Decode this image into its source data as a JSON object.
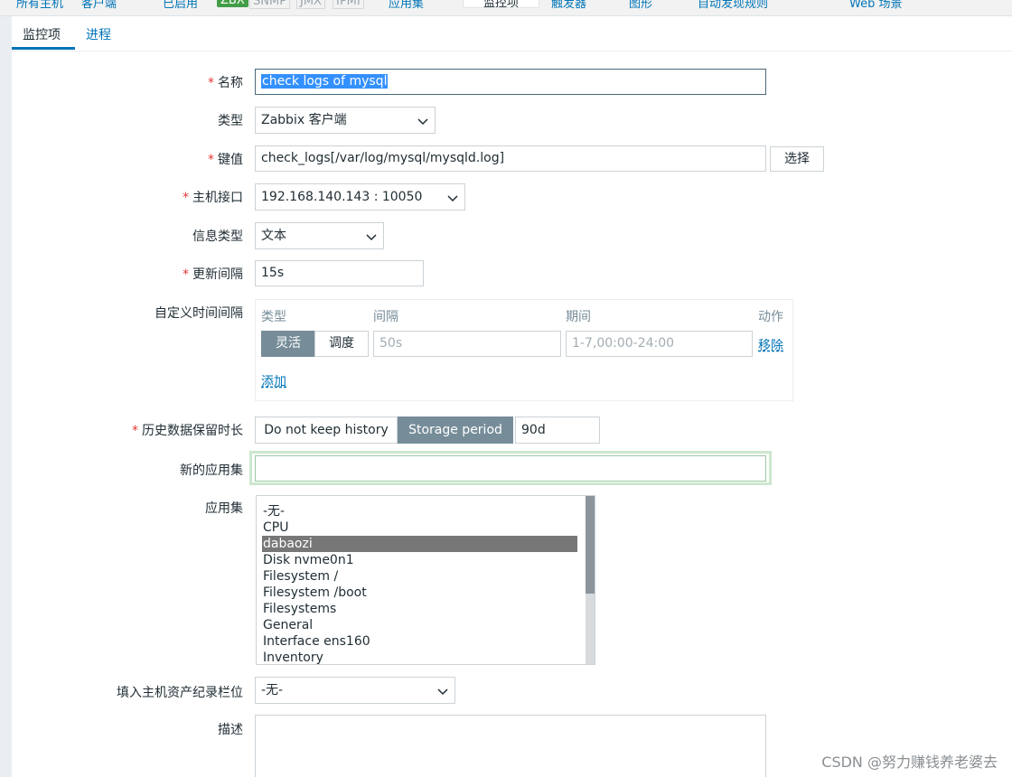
{
  "topnav": {
    "items": [
      "所有主机",
      "客户端",
      "已启用",
      "ZBX",
      "SNMP",
      "JMX",
      "IPMI",
      "应用集",
      "监控项",
      "触发器",
      "图形",
      "自动发现规则",
      "Web 场景"
    ]
  },
  "tabs": [
    {
      "label": "监控项"
    },
    {
      "label": "进程"
    }
  ],
  "form": {
    "name": {
      "label": "名称",
      "value": "check logs of mysql"
    },
    "type": {
      "label": "类型",
      "value": "Zabbix 客户端"
    },
    "key": {
      "label": "键值",
      "value": "check_logs[/var/log/mysql/mysqld.log]",
      "select_button": "选择"
    },
    "interface": {
      "label": "主机接口",
      "value": "192.168.140.143 : 10050"
    },
    "info_type": {
      "label": "信息类型",
      "value": "文本"
    },
    "update_interval": {
      "label": "更新间隔",
      "value": "15s"
    },
    "custom_intervals": {
      "label": "自定义时间间隔",
      "headers": {
        "type": "类型",
        "interval": "间隔",
        "period": "期间",
        "action": "动作"
      },
      "type_options": [
        "灵活",
        "调度"
      ],
      "interval_placeholder": "50s",
      "period_placeholder": "1-7,00:00-24:00",
      "remove": "移除",
      "add": "添加"
    },
    "history": {
      "label": "历史数据保留时长",
      "options": [
        "Do not keep history",
        "Storage period"
      ],
      "value": "90d"
    },
    "new_application": {
      "label": "新的应用集",
      "value": ""
    },
    "applications": {
      "label": "应用集",
      "items": [
        "-无-",
        "CPU",
        "dabaozi",
        "Disk nvme0n1",
        "Filesystem /",
        "Filesystem /boot",
        "Filesystems",
        "General",
        "Interface ens160",
        "Inventory"
      ],
      "selected": "dabaozi"
    },
    "inventory": {
      "label": "填入主机资产纪录栏位",
      "value": "-无-"
    },
    "description": {
      "label": "描述",
      "value": ""
    }
  },
  "watermark": "CSDN @努力赚钱养老婆去"
}
